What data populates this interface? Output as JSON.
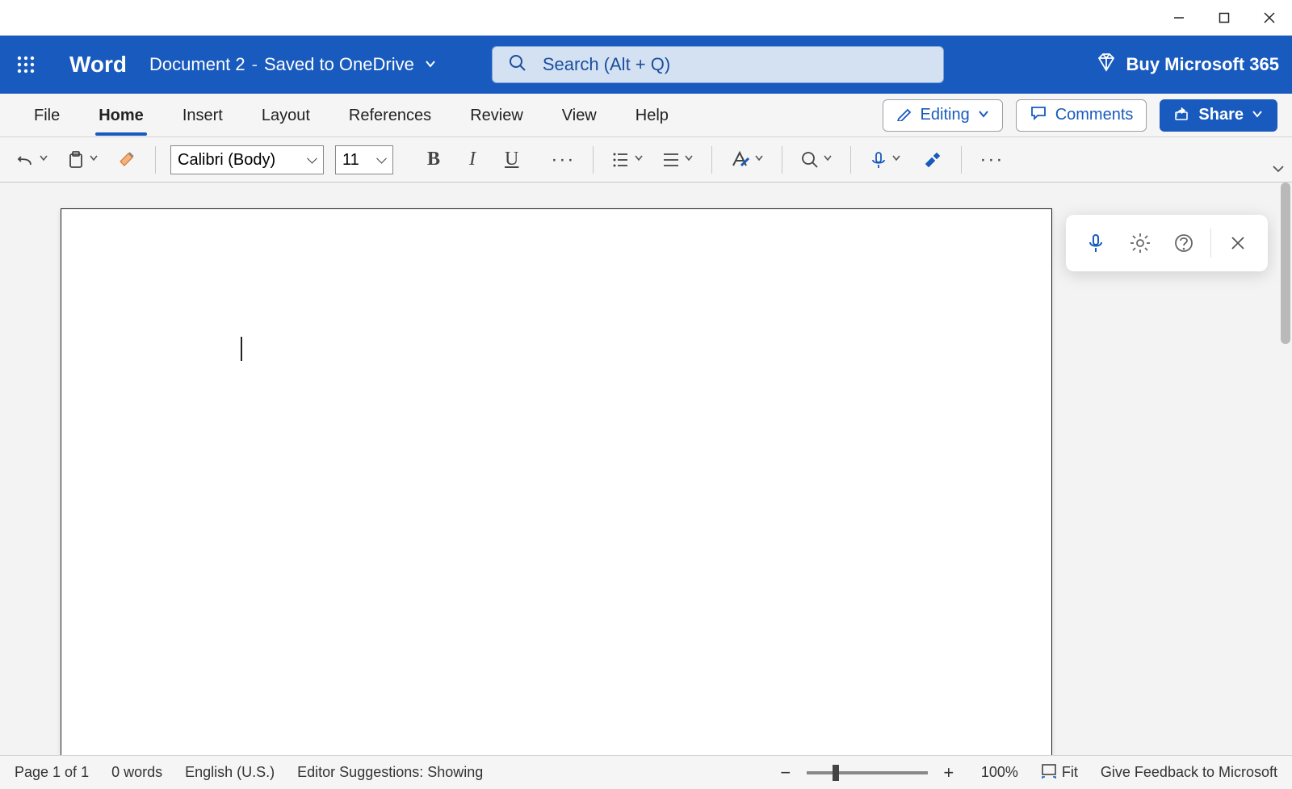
{
  "header": {
    "app_name": "Word",
    "doc_name": "Document 2",
    "save_status": "Saved to OneDrive",
    "search_placeholder": "Search (Alt + Q)",
    "buy_label": "Buy Microsoft 365"
  },
  "tabs": {
    "file": "File",
    "home": "Home",
    "insert": "Insert",
    "layout": "Layout",
    "references": "References",
    "review": "Review",
    "view": "View",
    "help": "Help"
  },
  "mode": {
    "editing": "Editing",
    "comments": "Comments",
    "share": "Share"
  },
  "toolbar": {
    "font_name": "Calibri (Body)",
    "font_size": "11"
  },
  "statusbar": {
    "page": "Page 1 of 1",
    "words": "0 words",
    "language": "English (U.S.)",
    "editor": "Editor Suggestions: Showing",
    "zoom_pct": "100%",
    "fit": "Fit",
    "feedback": "Give Feedback to Microsoft"
  },
  "colors": {
    "brand": "#185abd"
  }
}
